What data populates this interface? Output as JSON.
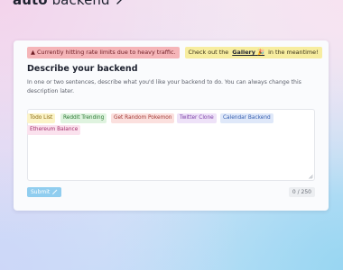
{
  "brand": {
    "part1": "auto",
    "part2": "backend"
  },
  "alerts": {
    "rate_limit_icon": "▲",
    "rate_limit_text": "Currently hitting rate limits due to heavy traffic.",
    "gallery_prefix": "Check out the",
    "gallery_link": "Gallery",
    "gallery_link_icon": "🎉",
    "gallery_suffix": "in the meantime!"
  },
  "form": {
    "title": "Describe your backend",
    "description": "In one or two sentences, describe what you'd like your backend to do. You can always change this description later.",
    "textarea_value": "",
    "submit_label": "Submit",
    "counter": "0 / 250"
  },
  "suggestions": {
    "todo": "Todo List",
    "reddit": "Reddit Trending",
    "pokemon": "Get Random Pokemon",
    "twitter": "Twitter Clone",
    "calendar": "Calendar Backend",
    "ethereum": "Ethereum Balance"
  },
  "colors": {
    "alert_red_bg": "#f5b5b8",
    "alert_yellow_bg": "#f7eda0",
    "submit_bg": "#90cdef",
    "card_bg": "#fafbfd"
  },
  "icons": {
    "brand_icon": "magic-wand-icon",
    "submit_icon": "magic-wand-icon",
    "warning_icon": "warning-triangle-icon",
    "gallery_icon": "party-popper-icon"
  }
}
